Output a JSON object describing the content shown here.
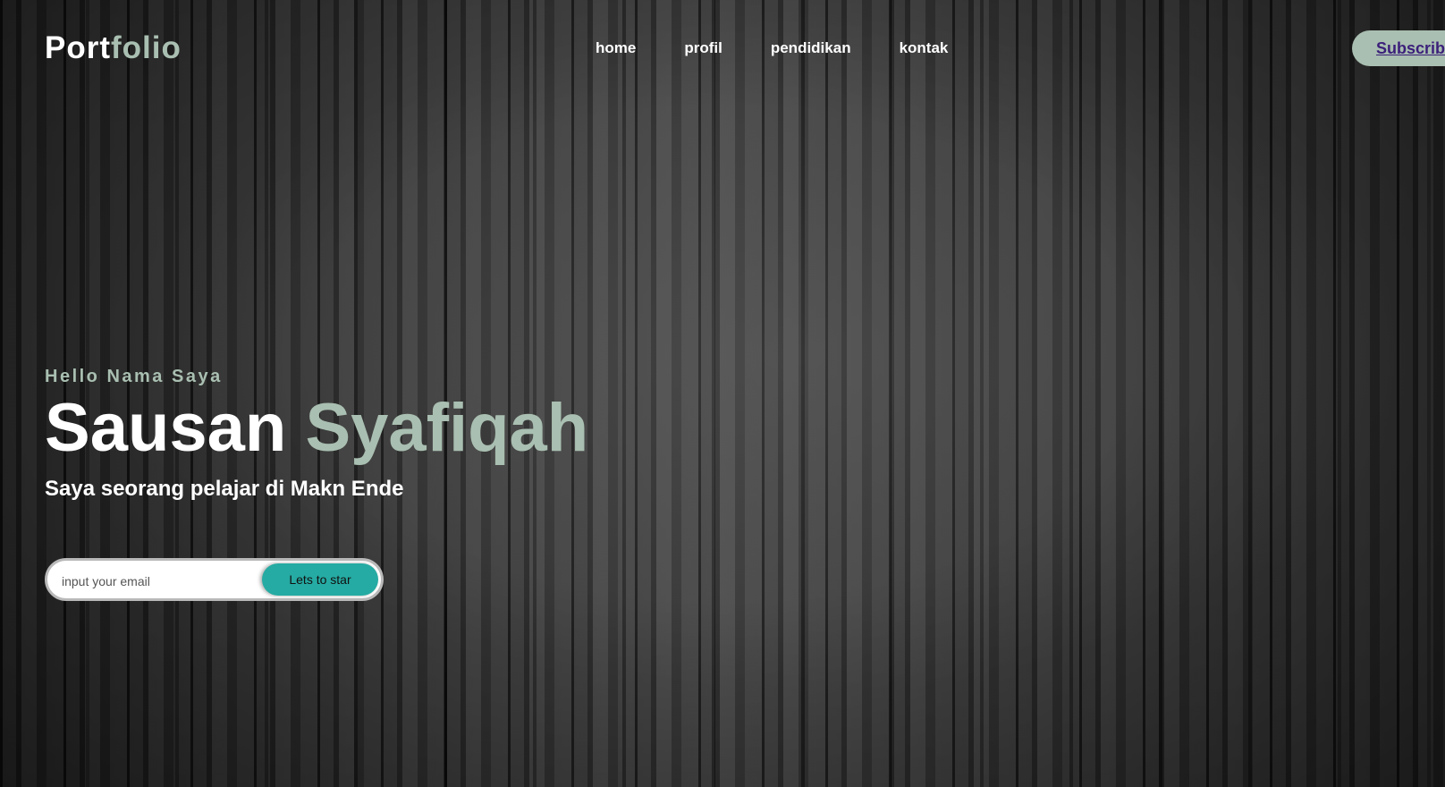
{
  "theme": {
    "accent": "#a9bfb1",
    "button_color": "#25aba3"
  },
  "navbar": {
    "logo": {
      "part1": "Port",
      "part2": "folio"
    },
    "links": [
      {
        "label": "home"
      },
      {
        "label": "profil"
      },
      {
        "label": "pendidikan"
      },
      {
        "label": "kontak"
      }
    ],
    "subscribe_label": "Subscribe"
  },
  "hero": {
    "greeting": "Hello Nama Saya",
    "first_name": "Sausan",
    "last_name": "Syafiqah",
    "tagline": "Saya seorang pelajar di Makn Ende"
  },
  "form": {
    "email_placeholder": "input your email",
    "email_value": "",
    "button_label": "Lets to star"
  }
}
